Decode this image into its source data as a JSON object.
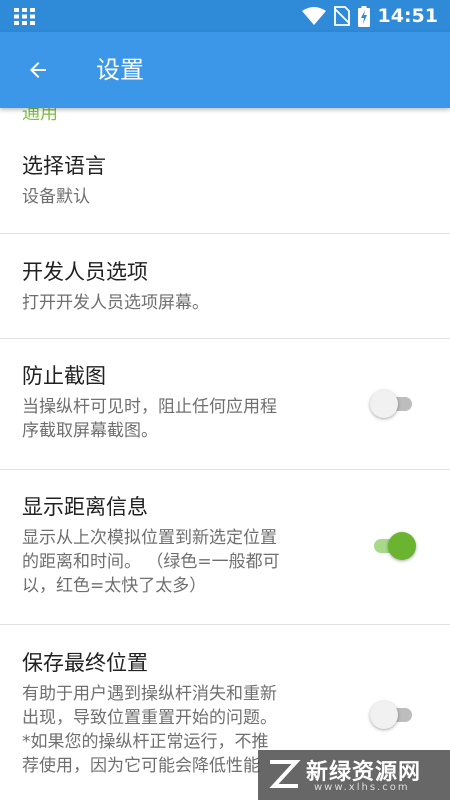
{
  "status_bar": {
    "time": "14:51",
    "icons": [
      "grid-apps-icon",
      "wifi-icon",
      "no-sim-icon",
      "battery-charging-icon"
    ]
  },
  "app_bar": {
    "back_icon": "arrow-left-icon",
    "title": "设置"
  },
  "section": {
    "header": "通用"
  },
  "settings": [
    {
      "title": "选择语言",
      "subtitle": "设备默认"
    },
    {
      "title": "开发人员选项",
      "subtitle": "打开开发人员选项屏幕。"
    },
    {
      "title": "防止截图",
      "subtitle_lines": [
        "当操纵杆可见时，阻止任何应用程",
        "序截取屏幕截图。"
      ],
      "switch": "off"
    },
    {
      "title": "显示距离信息",
      "subtitle_lines": [
        "显示从上次模拟位置到新选定位置",
        "的距离和时间。 （绿色=一般都可",
        "以，红色=太快了太多）"
      ],
      "switch": "on"
    },
    {
      "title": "保存最终位置",
      "subtitle_lines": [
        "有助于用户遇到操纵杆消失和重新",
        "出现，导致位置重置开始的问题。",
        "*如果您的操纵杆正常运行，不推",
        "荐使用，因为它可能会降低性能"
      ],
      "switch": "off"
    }
  ],
  "watermark": {
    "text": "新绿资源网",
    "url": "www.xlhs.com"
  },
  "colors": {
    "status_bar": "#2f8ad8",
    "app_bar": "#3d97e8",
    "section_header": "#7dc242",
    "switch_on": "#6ab42f"
  }
}
